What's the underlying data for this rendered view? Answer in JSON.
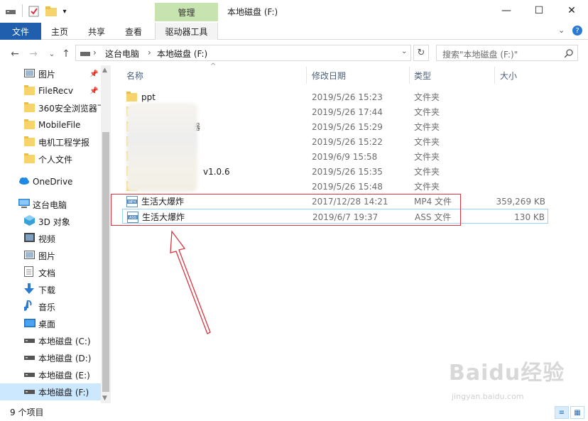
{
  "window": {
    "title": "本地磁盘 (F:)",
    "manage_tab": "管理",
    "minimize": "—",
    "maximize": "☐",
    "close": "✕"
  },
  "ribbon": {
    "tabs": [
      "文件",
      "主页",
      "共享",
      "查看",
      "驱动器工具"
    ]
  },
  "address": {
    "path": [
      "这台电脑",
      "本地磁盘 (F:)"
    ],
    "search_placeholder": "搜索\"本地磁盘 (F:)\""
  },
  "nav": {
    "items": [
      {
        "label": "图片",
        "icon": "pictures-icon",
        "pinned": true
      },
      {
        "label": "FileRecv",
        "icon": "folder-icon",
        "pinned": true
      },
      {
        "label": "360安全浏览器下",
        "icon": "folder-icon",
        "pinned": false
      },
      {
        "label": "MobileFile",
        "icon": "folder-icon",
        "pinned": false
      },
      {
        "label": "电机工程学报",
        "icon": "folder-icon",
        "pinned": false
      },
      {
        "label": "个人文件",
        "icon": "folder-icon",
        "pinned": false
      },
      {
        "label": "OneDrive",
        "icon": "cloud-icon",
        "pinned": false
      },
      {
        "label": "这台电脑",
        "icon": "computer-icon",
        "pinned": false
      },
      {
        "label": "3D 对象",
        "icon": "cube-icon",
        "pinned": false
      },
      {
        "label": "视频",
        "icon": "video-icon",
        "pinned": false
      },
      {
        "label": "图片",
        "icon": "pictures-icon",
        "pinned": false
      },
      {
        "label": "文档",
        "icon": "document-icon",
        "pinned": false
      },
      {
        "label": "下载",
        "icon": "download-icon",
        "pinned": false
      },
      {
        "label": "音乐",
        "icon": "music-icon",
        "pinned": false
      },
      {
        "label": "桌面",
        "icon": "desktop-icon",
        "pinned": false
      },
      {
        "label": "本地磁盘 (C:)",
        "icon": "drive-icon",
        "pinned": false
      },
      {
        "label": "本地磁盘 (D:)",
        "icon": "drive-icon",
        "pinned": false
      },
      {
        "label": "本地磁盘 (E:)",
        "icon": "drive-icon",
        "pinned": false
      },
      {
        "label": "本地磁盘 (F:)",
        "icon": "drive-icon",
        "pinned": false,
        "selected": true
      }
    ]
  },
  "columns": {
    "name": "名称",
    "date": "修改日期",
    "type": "类型",
    "size": "大小"
  },
  "files": [
    {
      "name": "ppt",
      "date": "2019/5/26 15:23",
      "type": "文件夹",
      "size": ""
    },
    {
      "name": "",
      "date": "2019/5/26 17:44",
      "type": "文件夹",
      "size": ""
    },
    {
      "name": "器",
      "date": "2019/5/26 15:29",
      "type": "文件夹",
      "size": ""
    },
    {
      "name": "",
      "date": "2019/5/26 15:22",
      "type": "文件夹",
      "size": ""
    },
    {
      "name": "",
      "date": "2019/6/9 15:58",
      "type": "文件夹",
      "size": ""
    },
    {
      "name": "v1.0.6",
      "date": "2019/5/26 15:35",
      "type": "文件夹",
      "size": ""
    },
    {
      "name": "",
      "date": "2019/5/26 15:48",
      "type": "文件夹",
      "size": ""
    },
    {
      "name": "生活大爆炸",
      "date": "2017/12/28 14:21",
      "type": "MP4 文件",
      "size": "359,269 KB",
      "icon": "mp4-file-icon"
    },
    {
      "name": "生活大爆炸",
      "date": "2019/6/7 19:37",
      "type": "ASS 文件",
      "size": "130 KB",
      "icon": "ass-file-icon"
    }
  ],
  "status": {
    "count": "9 个项目"
  },
  "watermark": {
    "main": "Baidu经验",
    "sub": "jingyan.baidu.com"
  },
  "colors": {
    "file_tab": "#1f5fae",
    "manage_tab": "#c7e3b0",
    "selection": "#cce8ff",
    "annotation": "#d9343f"
  }
}
